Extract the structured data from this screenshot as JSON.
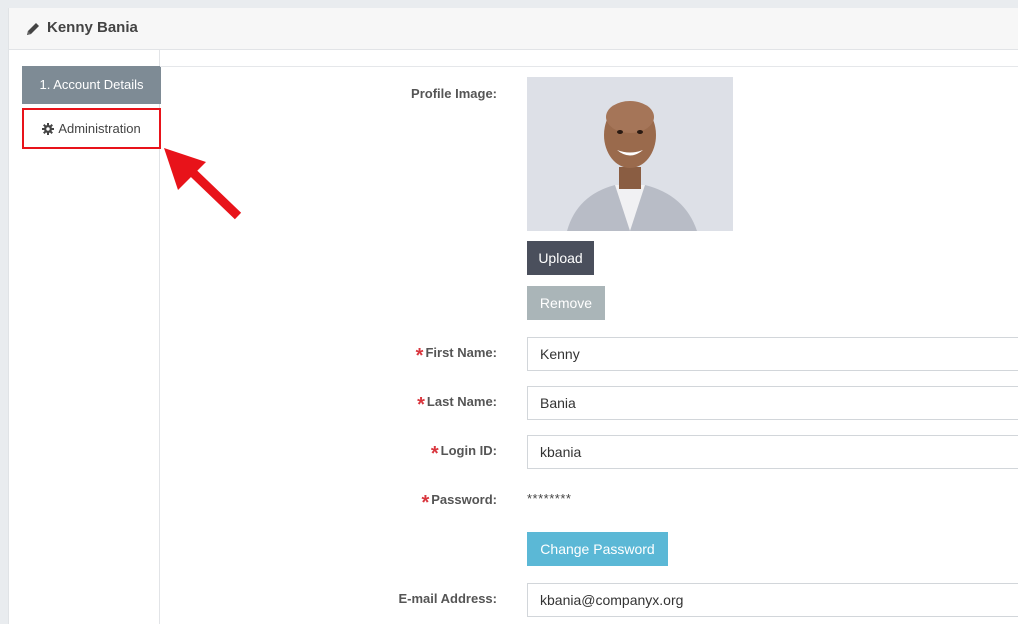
{
  "header": {
    "title": "Kenny Bania",
    "icon": "pencil-icon"
  },
  "sidebar": {
    "tabs": [
      {
        "label": "1. Account Details",
        "active": true
      },
      {
        "label": "Administration",
        "icon": "gear-icon",
        "highlighted": true
      }
    ]
  },
  "form": {
    "profile_image_label": "Profile Image:",
    "upload_label": "Upload",
    "remove_label": "Remove",
    "first_name_label": "First Name:",
    "first_name_value": "Kenny",
    "last_name_label": "Last Name:",
    "last_name_value": "Bania",
    "login_id_label": "Login ID:",
    "login_id_value": "kbania",
    "password_label": "Password:",
    "password_value": "********",
    "change_password_label": "Change Password",
    "email_label": "E-mail Address:",
    "email_value": "kbania@companyx.org",
    "required_marker": "*"
  },
  "colors": {
    "active_tab": "#7e8b95",
    "highlight_border": "#e8131a",
    "upload_button": "#4a4f5c",
    "remove_button": "#aab5b8",
    "change_password_button": "#5bb8d6",
    "required_star": "#d9363e"
  }
}
